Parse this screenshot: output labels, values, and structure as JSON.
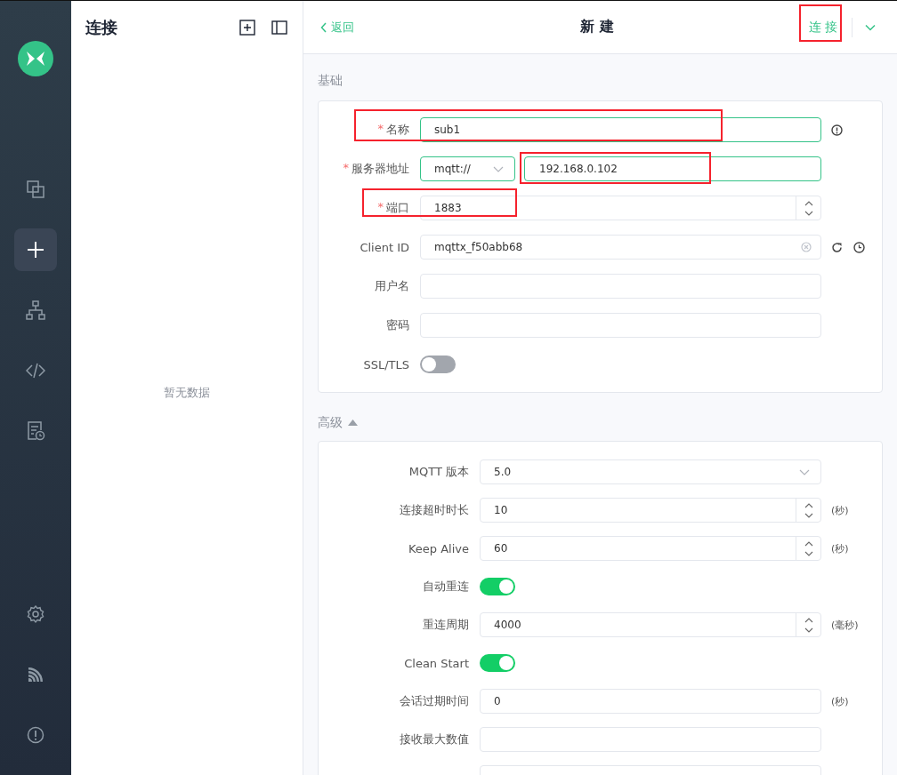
{
  "sidebar": {
    "items": [
      {
        "kind": "connections",
        "selected": false
      },
      {
        "kind": "new",
        "selected": true
      },
      {
        "kind": "topology",
        "selected": false
      },
      {
        "kind": "script",
        "selected": false
      },
      {
        "kind": "log",
        "selected": false
      }
    ],
    "bottom_items": [
      {
        "kind": "settings"
      },
      {
        "kind": "feed"
      },
      {
        "kind": "about"
      }
    ]
  },
  "connections_panel": {
    "title": "连接",
    "empty_text": "暂无数据"
  },
  "header": {
    "back": "返回",
    "title": "新建",
    "connect": "连接",
    "connect_annotated": true
  },
  "basic": {
    "title": "基础",
    "fields": [
      {
        "kind": "text",
        "label": "名称",
        "marker": "*",
        "value": "sub1",
        "active": true,
        "annotated": true,
        "info": true
      },
      {
        "kind": "address",
        "label": "服务器地址",
        "marker": "*",
        "protocol": "mqtt://",
        "value": "192.168.0.102",
        "active": true,
        "annotated": true
      },
      {
        "kind": "number",
        "label": "端口",
        "marker": "*",
        "value": "1883",
        "active": false,
        "annotated": true
      },
      {
        "kind": "client_id",
        "label": "Client ID",
        "value": "mqttx_f50abb68",
        "active": false
      },
      {
        "kind": "text",
        "label": "用户名",
        "active": false
      },
      {
        "kind": "text",
        "label": "密码",
        "active": false
      },
      {
        "kind": "switch",
        "label": "SSL/TLS",
        "on": false
      }
    ]
  },
  "advanced": {
    "title": "高级",
    "expanded": true,
    "fields": [
      {
        "kind": "select",
        "label": "MQTT 版本",
        "value": "5.0"
      },
      {
        "kind": "number",
        "label": "连接超时时长",
        "value": "10",
        "unit": "(秒)"
      },
      {
        "kind": "number",
        "label": "Keep Alive",
        "value": "60",
        "unit": "(秒)"
      },
      {
        "kind": "switch",
        "label": "自动重连",
        "on": true
      },
      {
        "kind": "number",
        "label": "重连周期",
        "value": "4000",
        "unit": "(毫秒)"
      },
      {
        "kind": "switch",
        "label": "Clean Start",
        "on": true
      },
      {
        "kind": "text",
        "label": "会话过期时间",
        "value": "0",
        "unit": "(秒)"
      },
      {
        "kind": "text",
        "label": "接收最大数值"
      },
      {
        "kind": "text"
      }
    ]
  }
}
